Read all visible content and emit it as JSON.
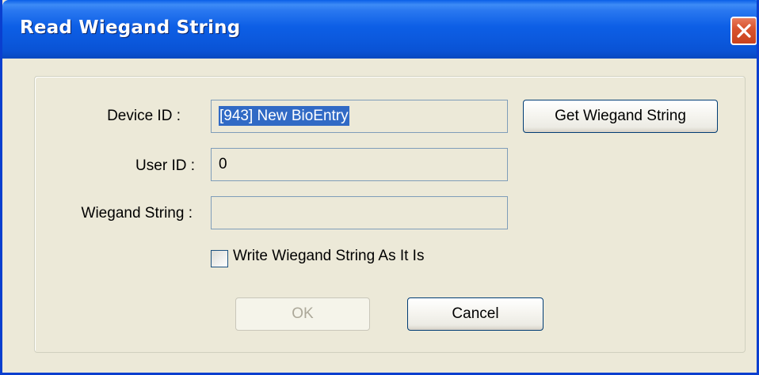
{
  "window": {
    "title": "Read Wiegand String"
  },
  "form": {
    "device_id_label": "Device ID :",
    "device_id_value": "[943] New BioEntry",
    "user_id_label": "User ID :",
    "user_id_value": "0",
    "wiegand_string_label": "Wiegand String :",
    "wiegand_string_value": "",
    "write_as_is_label": "Write Wiegand String As It Is",
    "write_as_is_checked": false
  },
  "buttons": {
    "get_wiegand_string": "Get Wiegand String",
    "ok": "OK",
    "ok_enabled": false,
    "cancel": "Cancel"
  },
  "icons": {
    "close": "close-icon"
  },
  "colors": {
    "titlebar": "#0a5fe8",
    "close_button": "#d9542f",
    "selection": "#316ac5",
    "dialog_background": "#ece9d8"
  }
}
